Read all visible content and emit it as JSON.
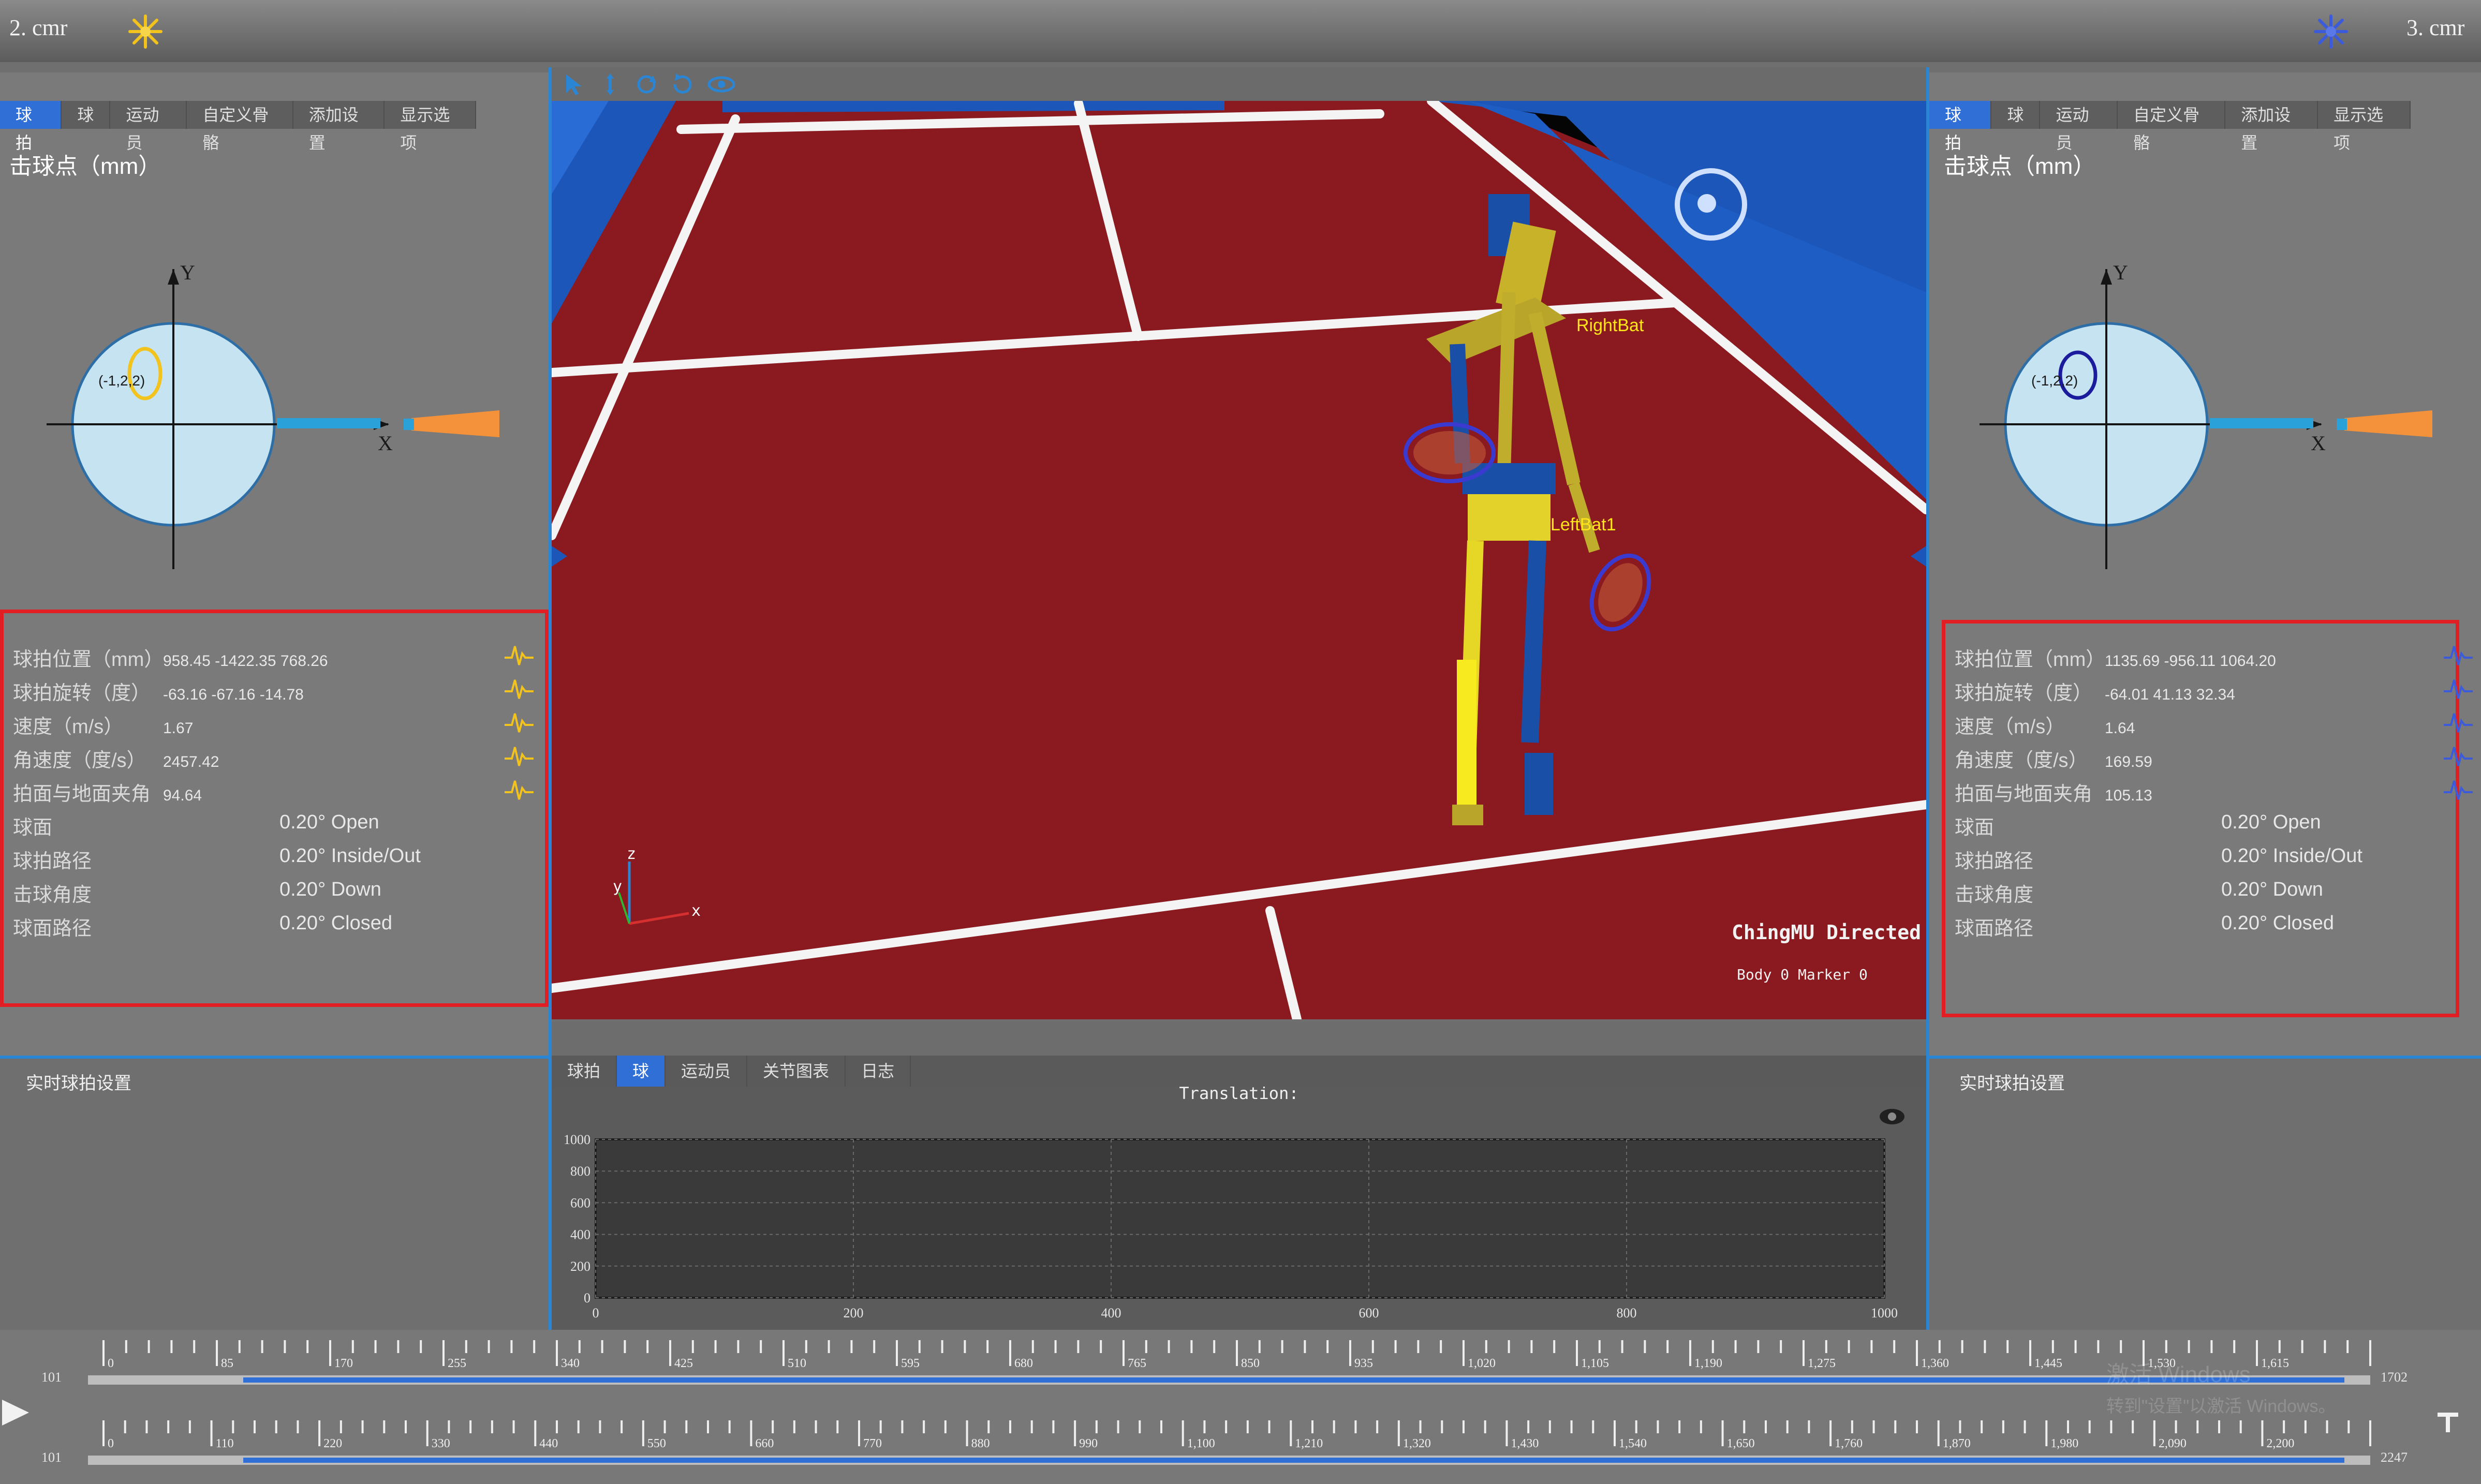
{
  "cameras": {
    "left": "2. cmr",
    "right": "3. cmr"
  },
  "colors": {
    "accent": "#2f6fd6",
    "highlight_border": "#e01e23",
    "court": "#8a1a1f",
    "wave_left": "#f2c31c",
    "wave_right": "#3b5bdb",
    "ball_marker_left": "#f2c31c",
    "ball_marker_right": "#1b1b9e"
  },
  "panel_tabs": [
    "球拍",
    "球",
    "运动员",
    "自定义骨骼",
    "添加设置",
    "显示选项"
  ],
  "left_panel": {
    "title": "击球点（mm）",
    "diagram": {
      "y_label": "Y",
      "x_label": "X",
      "point_label": "(-1,2,2)"
    },
    "rows": [
      {
        "label": "球拍位置（mm）",
        "values": "958.45    -1422.35  768.26"
      },
      {
        "label": "球拍旋转（度）",
        "values": "-63.16    -67.16    -14.78"
      },
      {
        "label": "速度（m/s）",
        "values": "1.67"
      },
      {
        "label": "角速度（度/s）",
        "values": "2457.42"
      },
      {
        "label": "拍面与地面夹角",
        "values": "94.64"
      },
      {
        "label": "球面",
        "hvalue": "0.20° Open"
      },
      {
        "label": "球拍路径",
        "hvalue": "0.20° Inside/Out"
      },
      {
        "label": "击球角度",
        "hvalue": "0.20° Down"
      },
      {
        "label": "球面路径",
        "hvalue": "0.20° Closed"
      }
    ],
    "section": "实时球拍设置"
  },
  "right_panel": {
    "title": "击球点（mm）",
    "diagram": {
      "y_label": "Y",
      "x_label": "X",
      "point_label": "(-1,2,2)"
    },
    "rows": [
      {
        "label": "球拍位置（mm）",
        "values": "1135.69   -956.11   1064.20"
      },
      {
        "label": "球拍旋转（度）",
        "values": "-64.01    41.13     32.34"
      },
      {
        "label": "速度（m/s）",
        "values": "1.64"
      },
      {
        "label": "角速度（度/s）",
        "values": "169.59"
      },
      {
        "label": "拍面与地面夹角",
        "values": "105.13"
      },
      {
        "label": "球面",
        "hvalue": "0.20° Open"
      },
      {
        "label": "球拍路径",
        "hvalue": "0.20° Inside/Out"
      },
      {
        "label": "击球角度",
        "hvalue": "0.20° Down"
      },
      {
        "label": "球面路径",
        "hvalue": "0.20° Closed"
      }
    ],
    "section": "实时球拍设置"
  },
  "viewport": {
    "label_right_bat": "RightBat",
    "label_left_bat": "LeftBat1",
    "overlay_title": "ChingMU Directed",
    "overlay_status": "Body  0 Marker  0",
    "axes": {
      "z": "z",
      "y": "y",
      "x": "x"
    }
  },
  "bottom_tabs": [
    "球拍",
    "球",
    "运动员",
    "关节图表",
    "日志"
  ],
  "chart_data": {
    "type": "line",
    "title": "Translation:",
    "x_ticks": [
      0,
      200,
      400,
      600,
      800,
      1000
    ],
    "y_ticks": [
      0,
      200,
      400,
      600,
      800,
      1000
    ],
    "xlim": [
      0,
      1000
    ],
    "ylim": [
      0,
      1000
    ],
    "grid": true,
    "series": []
  },
  "timeline1": {
    "start": "101",
    "end": "1702",
    "ticks": [
      "0",
      "85",
      "170",
      "255",
      "340",
      "425",
      "510",
      "595",
      "680",
      "765",
      "850",
      "935",
      "1,020",
      "1,105",
      "1,190",
      "1,275",
      "1,360",
      "1,445",
      "1,530",
      "1,615"
    ]
  },
  "timeline2": {
    "start": "101",
    "end": "2247",
    "ticks": [
      "0",
      "110",
      "220",
      "330",
      "440",
      "550",
      "660",
      "770",
      "880",
      "990",
      "1,100",
      "1,210",
      "1,320",
      "1,430",
      "1,540",
      "1,650",
      "1,760",
      "1,870",
      "1,980",
      "2,090",
      "2,200"
    ]
  },
  "watermark": {
    "line1": "激活 Windows",
    "line2": "转到\"设置\"以激活 Windows。"
  }
}
